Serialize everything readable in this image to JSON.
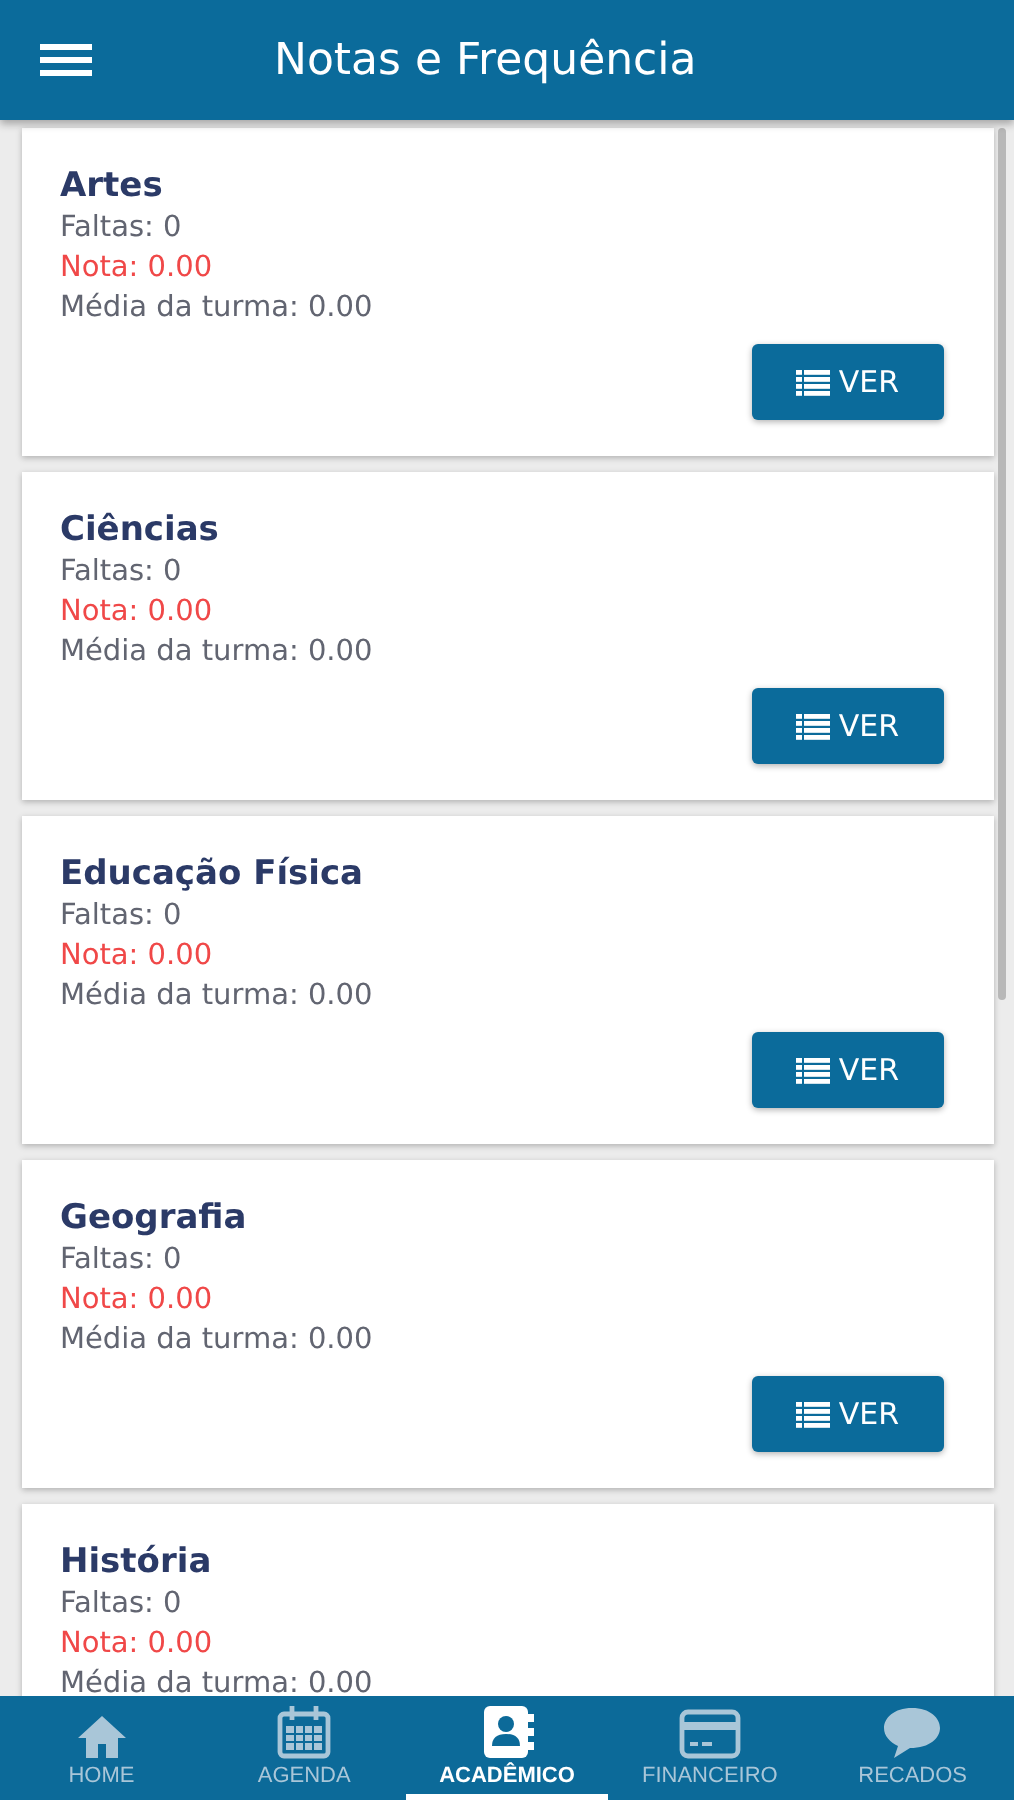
{
  "header": {
    "title": "Notas e Frequência"
  },
  "subjects": [
    {
      "name": "Artes",
      "faltas": "Faltas: 0",
      "nota": "Nota: 0.00",
      "media": "Média da turma: 0.00",
      "button": "VER"
    },
    {
      "name": "Ciências",
      "faltas": "Faltas: 0",
      "nota": "Nota: 0.00",
      "media": "Média da turma: 0.00",
      "button": "VER"
    },
    {
      "name": "Educação Física",
      "faltas": "Faltas: 0",
      "nota": "Nota: 0.00",
      "media": "Média da turma: 0.00",
      "button": "VER"
    },
    {
      "name": "Geografia",
      "faltas": "Faltas: 0",
      "nota": "Nota: 0.00",
      "media": "Média da turma: 0.00",
      "button": "VER"
    },
    {
      "name": "História",
      "faltas": "Faltas: 0",
      "nota": "Nota: 0.00",
      "media": "Média da turma: 0.00"
    }
  ],
  "bottom_nav": [
    {
      "label": "HOME",
      "kind": "home",
      "selected": false
    },
    {
      "label": "AGENDA",
      "kind": "calendar",
      "selected": false
    },
    {
      "label": "ACADÊMICO",
      "kind": "contacts",
      "selected": true
    },
    {
      "label": "FINANCEIRO",
      "kind": "card",
      "selected": false
    },
    {
      "label": "RECADOS",
      "kind": "chat",
      "selected": false
    }
  ]
}
